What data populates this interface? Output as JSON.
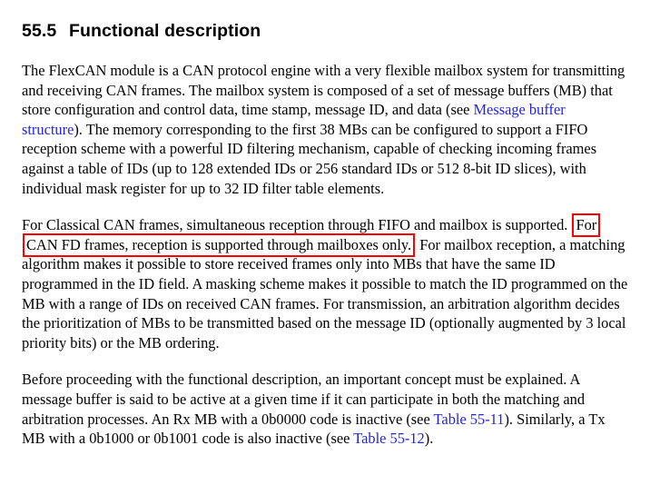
{
  "document": {
    "heading": {
      "number": "55.5",
      "title": "Functional description"
    },
    "paragraphs": [
      {
        "id": "intro",
        "segments": [
          {
            "type": "text",
            "text": "The FlexCAN module is a CAN protocol engine with a very flexible mailbox system for transmitting and receiving CAN frames. The mailbox system is composed of a set of message buffers (MB) that store configuration and control data, time stamp, message ID, and data (see "
          },
          {
            "type": "link",
            "text": "Message buffer structure"
          },
          {
            "type": "text",
            "text": "). The memory corresponding to the first 38 MBs can be configured to support a FIFO reception scheme with a powerful ID filtering mechanism, capable of checking incoming frames against a table of IDs (up to 128 extended IDs or 256 standard IDs or 512 8-bit ID slices), with individual mask register for up to 32 ID filter table elements."
          }
        ]
      },
      {
        "id": "reception",
        "segments": [
          {
            "type": "text",
            "text": "For Classical CAN frames, simultaneous reception through FIFO and mailbox is supported."
          },
          {
            "type": "highlight",
            "text": "For CAN FD frames, reception is supported through mailboxes only."
          },
          {
            "type": "text",
            "text": "For mailbox reception, a matching algorithm makes it possible to store received frames only into MBs that have the same ID programmed in the ID field. A masking scheme makes it possible to match the ID programmed on the MB with a range of IDs on received CAN frames. For transmission, an arbitration algorithm decides the prioritization of MBs to be transmitted based on the message ID (optionally augmented by 3 local priority bits) or the MB ordering."
          }
        ]
      },
      {
        "id": "active-mb",
        "segments": [
          {
            "type": "text",
            "text": "Before proceeding with the functional description, an important concept must be explained. A message buffer is said to be active at a given time if it can participate in both the matching and arbitration processes. An Rx MB with a 0b0000 code is inactive (see "
          },
          {
            "type": "link",
            "text": "Table 55-11"
          },
          {
            "type": "text",
            "text": "). Similarly, a Tx MB with a 0b1000 or 0b1001 code is also inactive (see "
          },
          {
            "type": "link",
            "text": "Table 55-12"
          },
          {
            "type": "text",
            "text": ")."
          }
        ]
      }
    ],
    "colors": {
      "page_background": "#ffffff",
      "body_text": "#000000",
      "link": "#1f1fee",
      "annotation_box_border": "#ff0000"
    },
    "annotation": {
      "type": "red-rectangle-highlight",
      "target_text": "For CAN FD frames, reception is supported through mailboxes only."
    }
  }
}
